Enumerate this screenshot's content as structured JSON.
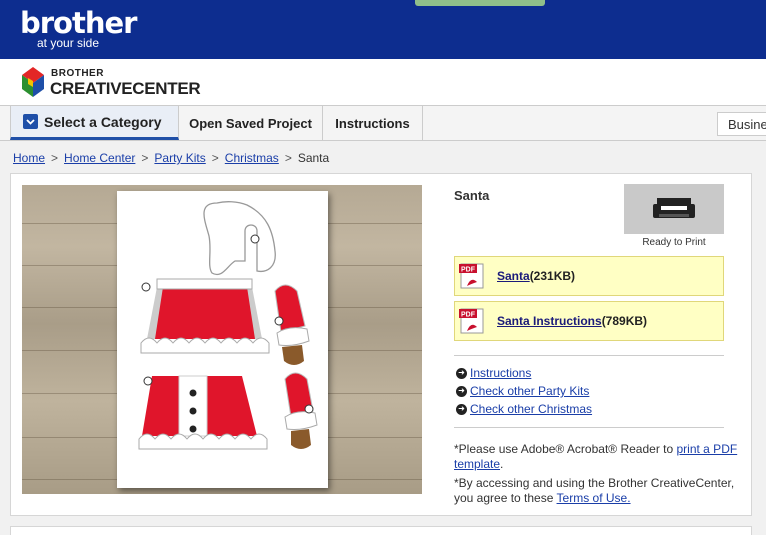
{
  "banner": {
    "brand_name": "brother",
    "brand_tagline": "at your side"
  },
  "site_logo": {
    "line1": "BROTHER",
    "line2": "CREATIVECENTER"
  },
  "nav": {
    "category_label": "Select a Category",
    "saved_label": "Open Saved Project",
    "instructions_label": "Instructions",
    "business_label": "Business"
  },
  "breadcrumb": {
    "items": [
      "Home",
      "Home Center",
      "Party Kits",
      "Christmas"
    ],
    "current": "Santa",
    "separator": ">"
  },
  "product": {
    "title": "Santa",
    "print_caption": "Ready to Print",
    "files": [
      {
        "name": "Santa",
        "size": "(231KB)"
      },
      {
        "name": "Santa Instructions",
        "size": "(789KB)"
      }
    ],
    "links": [
      "Instructions",
      "Check other Party Kits",
      "Check other Christmas"
    ],
    "note1_prefix": "*Please use Adobe® Acrobat® Reader to ",
    "note1_link": "print a PDF template",
    "note1_suffix": ".",
    "note2_prefix": "*By accessing and using the Brother CreativeCenter, you agree to these ",
    "note2_link": "Terms of Use."
  },
  "colors": {
    "banner_blue": "#0d2d8f",
    "nav_accent": "#1e4fa8",
    "link_blue": "#1a3ea8",
    "file_highlight": "#ffffc4",
    "santa_red": "#e0152b"
  },
  "icons": {
    "category": "chevron-down-icon",
    "print": "printer-icon",
    "pdf": "pdf-file-icon",
    "link": "arrow-circle-icon"
  }
}
